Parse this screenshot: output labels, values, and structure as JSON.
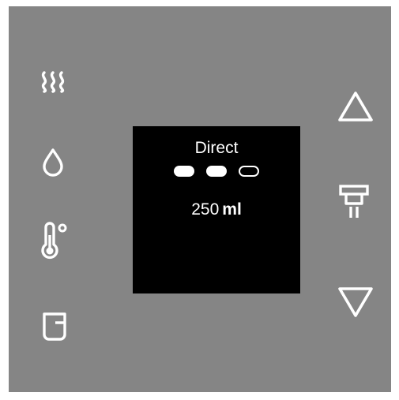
{
  "screen": {
    "mode_label": "Direct",
    "strength_level": 2,
    "strength_max": 3,
    "volume_value": "250",
    "volume_unit": "ml"
  },
  "left_buttons": [
    {
      "icon": "steam-icon"
    },
    {
      "icon": "water-drop-icon"
    },
    {
      "icon": "thermometer-icon"
    },
    {
      "icon": "cup-icon"
    }
  ],
  "right_buttons": [
    {
      "icon": "arrow-up-icon"
    },
    {
      "icon": "brew-unit-icon"
    },
    {
      "icon": "arrow-down-icon"
    }
  ],
  "colors": {
    "panel_background": "#858585",
    "screen_background": "#000000",
    "foreground": "#ffffff"
  }
}
